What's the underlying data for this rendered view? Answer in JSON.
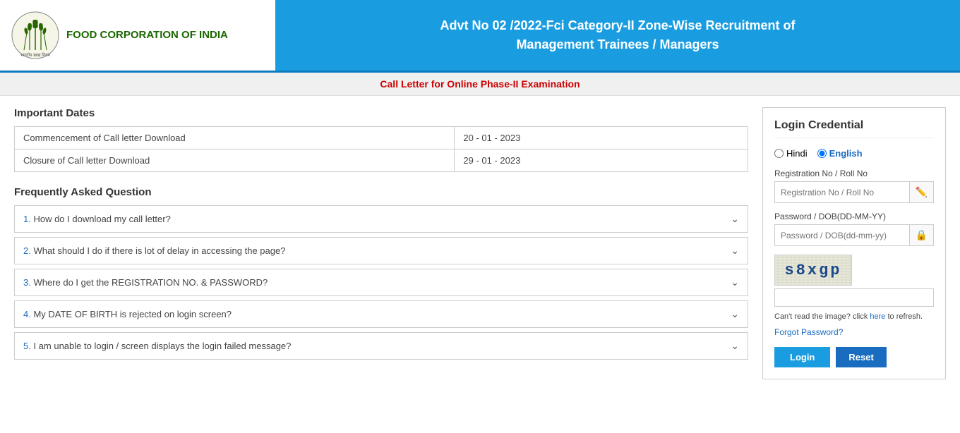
{
  "header": {
    "org_name": "FOOD CORPORATION OF INDIA",
    "title_line1": "Advt No 02 /2022-Fci Category-II Zone-Wise Recruitment of",
    "title_line2": "Management Trainees / Managers"
  },
  "sub_header": {
    "text": "Call Letter for Online Phase-II Examination"
  },
  "important_dates": {
    "section_title": "Important Dates",
    "rows": [
      {
        "label": "Commencement of Call letter Download",
        "value": "20 - 01 - 2023"
      },
      {
        "label": "Closure of Call letter Download",
        "value": "29 - 01 - 2023"
      }
    ]
  },
  "faq": {
    "section_title": "Frequently Asked Question",
    "items": [
      {
        "id": "1",
        "text": "How do I download my call letter?"
      },
      {
        "id": "2",
        "text": "What should I do if there is lot of delay in accessing the page?"
      },
      {
        "id": "3",
        "text": "Where do I get the REGISTRATION NO. & PASSWORD?"
      },
      {
        "id": "4",
        "text": "My DATE OF BIRTH is rejected on login screen?"
      },
      {
        "id": "5",
        "text": "I am unable to login / screen displays the login failed message?"
      }
    ]
  },
  "login": {
    "title": "Login Credential",
    "lang_hindi": "Hindi",
    "lang_english": "English",
    "reg_label": "Registration No / Roll No",
    "reg_placeholder": "Registration No / Roll No",
    "pass_label": "Password / DOB(DD-MM-YY)",
    "pass_placeholder": "Password / DOB(dd-mm-yy)",
    "captcha_text": "s8xgp",
    "captcha_input_placeholder": "",
    "cant_read": "Can't read the image? click",
    "here_link": "here",
    "to_refresh": "to refresh.",
    "forgot_password": "Forgot Password?",
    "login_btn": "Login",
    "reset_btn": "Reset"
  }
}
